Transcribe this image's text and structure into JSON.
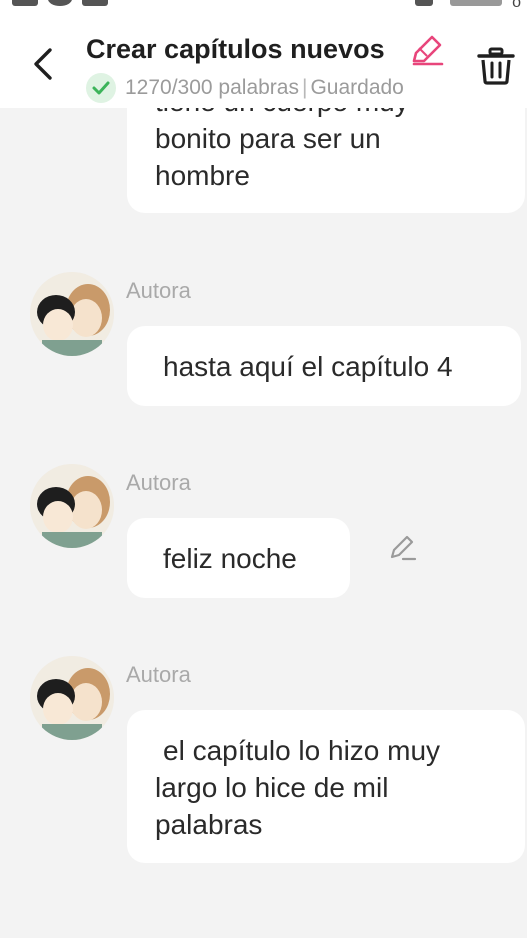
{
  "header": {
    "title": "Crear capítulos nuevos",
    "word_count": "1270/300 palabras",
    "separator": "|",
    "save_status": "Guardado"
  },
  "messages": [
    {
      "text_lines": [
        "tiene un cuerpo muy",
        "bonito para ser un",
        "hombre"
      ]
    },
    {
      "author": "Autora",
      "text": "hasta aquí el capítulo 4"
    },
    {
      "author": "Autora",
      "text": "feliz noche"
    },
    {
      "author": "Autora",
      "text_lines": [
        "el capítulo lo hizo muy",
        "largo lo hice de mil",
        "palabras"
      ]
    }
  ],
  "colors": {
    "accent_pink": "#e8457b",
    "check_green": "#3cb45a",
    "background": "#f3f3f3",
    "bubble": "#ffffff"
  },
  "icons": {
    "back": "chevron-left-icon",
    "title_edit": "pencil-icon",
    "saved": "check-icon",
    "delete": "trash-icon",
    "message_edit": "pencil-icon"
  }
}
